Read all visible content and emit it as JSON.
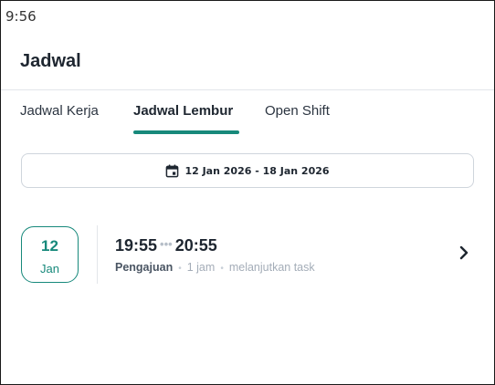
{
  "status_bar": {
    "time": "9:56"
  },
  "header": {
    "title": "Jadwal"
  },
  "tabs": [
    {
      "label": "Jadwal Kerja",
      "active": false
    },
    {
      "label": "Jadwal Lembur",
      "active": true
    },
    {
      "label": "Open Shift",
      "active": false
    }
  ],
  "date_range": {
    "icon": "calendar-icon",
    "label": "12 Jan 2026 - 18 Jan 2026"
  },
  "overtime_items": [
    {
      "day": "12",
      "month": "Jan",
      "start_time": "19:55",
      "separator": "•••",
      "end_time": "20:55",
      "status": "Pengajuan",
      "duration": "1 jam",
      "note": "melanjutkan task",
      "icon": "chevron-right-icon"
    }
  ],
  "colors": {
    "accent": "#17897b",
    "text_primary": "#1e2630",
    "text_muted": "#a4adb8",
    "border": "#cfd5dc"
  }
}
